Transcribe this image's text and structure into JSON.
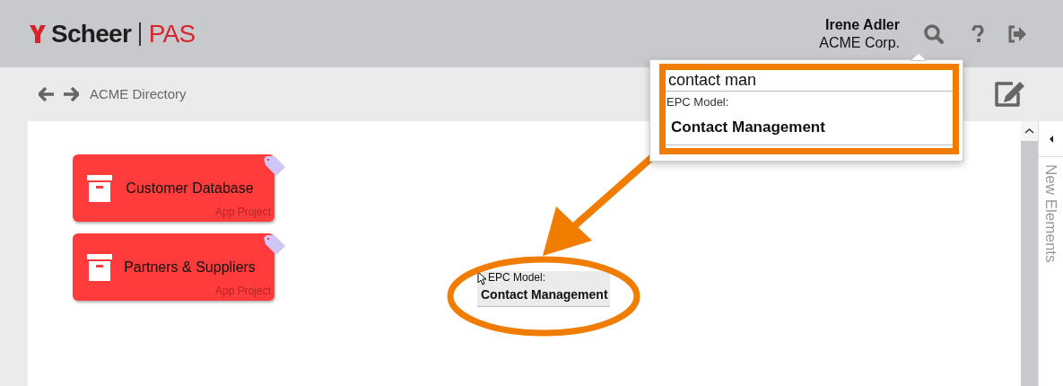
{
  "header": {
    "logo_mark": "Scheer",
    "logo_product": "PAS",
    "user_name": "Irene Adler",
    "company": "ACME Corp."
  },
  "breadcrumb": {
    "title": "ACME Directory"
  },
  "search": {
    "value": "contact man",
    "results": [
      {
        "type": "EPC Model:",
        "name": "Contact Management"
      }
    ]
  },
  "cards": [
    {
      "title": "Customer Database",
      "kind_label": "App Project"
    },
    {
      "title": "Partners & Suppliers",
      "kind_label": "App Project"
    }
  ],
  "dragged_item": {
    "type": "EPC Model:",
    "name": "Contact Management"
  },
  "side_panel": {
    "title": "New Elements"
  }
}
